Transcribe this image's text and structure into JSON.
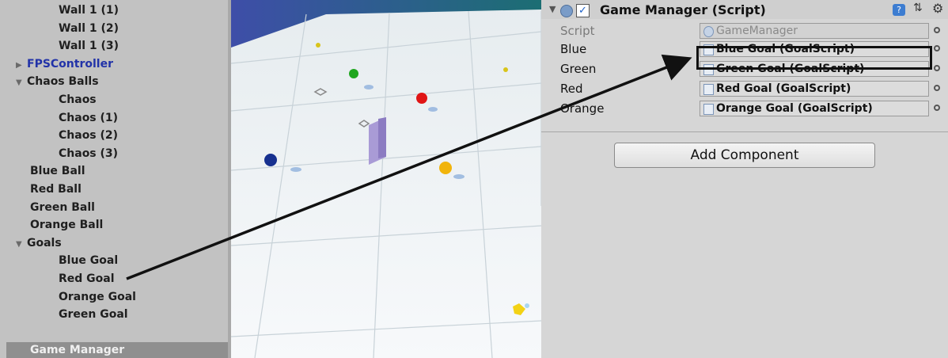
{
  "hierarchy": {
    "items": [
      {
        "label": "Wall 1 (1)",
        "indent": 2,
        "arrow": ""
      },
      {
        "label": "Wall 1 (2)",
        "indent": 2,
        "arrow": ""
      },
      {
        "label": "Wall 1 (3)",
        "indent": 2,
        "arrow": ""
      },
      {
        "label": "FPSController",
        "indent": 0,
        "arrow": "▶",
        "prefab": true
      },
      {
        "label": "Chaos Balls",
        "indent": 0,
        "arrow": "▼"
      },
      {
        "label": "Chaos",
        "indent": 2,
        "arrow": ""
      },
      {
        "label": "Chaos (1)",
        "indent": 2,
        "arrow": ""
      },
      {
        "label": "Chaos (2)",
        "indent": 2,
        "arrow": ""
      },
      {
        "label": "Chaos (3)",
        "indent": 2,
        "arrow": ""
      },
      {
        "label": "Blue Ball",
        "indent": 1,
        "arrow": ""
      },
      {
        "label": "Red Ball",
        "indent": 1,
        "arrow": ""
      },
      {
        "label": "Green Ball",
        "indent": 1,
        "arrow": ""
      },
      {
        "label": "Orange Ball",
        "indent": 1,
        "arrow": ""
      },
      {
        "label": "Goals",
        "indent": 0,
        "arrow": "▼"
      },
      {
        "label": "Blue Goal",
        "indent": 2,
        "arrow": ""
      },
      {
        "label": "Red Goal",
        "indent": 2,
        "arrow": ""
      },
      {
        "label": "Orange Goal",
        "indent": 2,
        "arrow": ""
      },
      {
        "label": "Green Goal",
        "indent": 2,
        "arrow": ""
      }
    ],
    "selected": "Game Manager"
  },
  "inspector": {
    "component_title": "Game Manager (Script)",
    "enabled": true,
    "properties": [
      {
        "label": "Script",
        "value": "GameManager",
        "dim": true
      },
      {
        "label": "Blue",
        "value": "Blue Goal (GoalScript)",
        "dim": false
      },
      {
        "label": "Green",
        "value": "Green Goal (GoalScript)",
        "dim": false
      },
      {
        "label": "Red",
        "value": "Red Goal (GoalScript)",
        "dim": false
      },
      {
        "label": "Orange",
        "value": "Orange Goal (GoalScript)",
        "dim": false
      }
    ],
    "add_component_label": "Add Component"
  },
  "icons": {
    "foldout": "foldout-triangle-icon",
    "script": "script-icon",
    "help": "help-icon",
    "preset": "preset-icon",
    "settings": "gear-icon",
    "object_picker": "object-picker-icon"
  }
}
